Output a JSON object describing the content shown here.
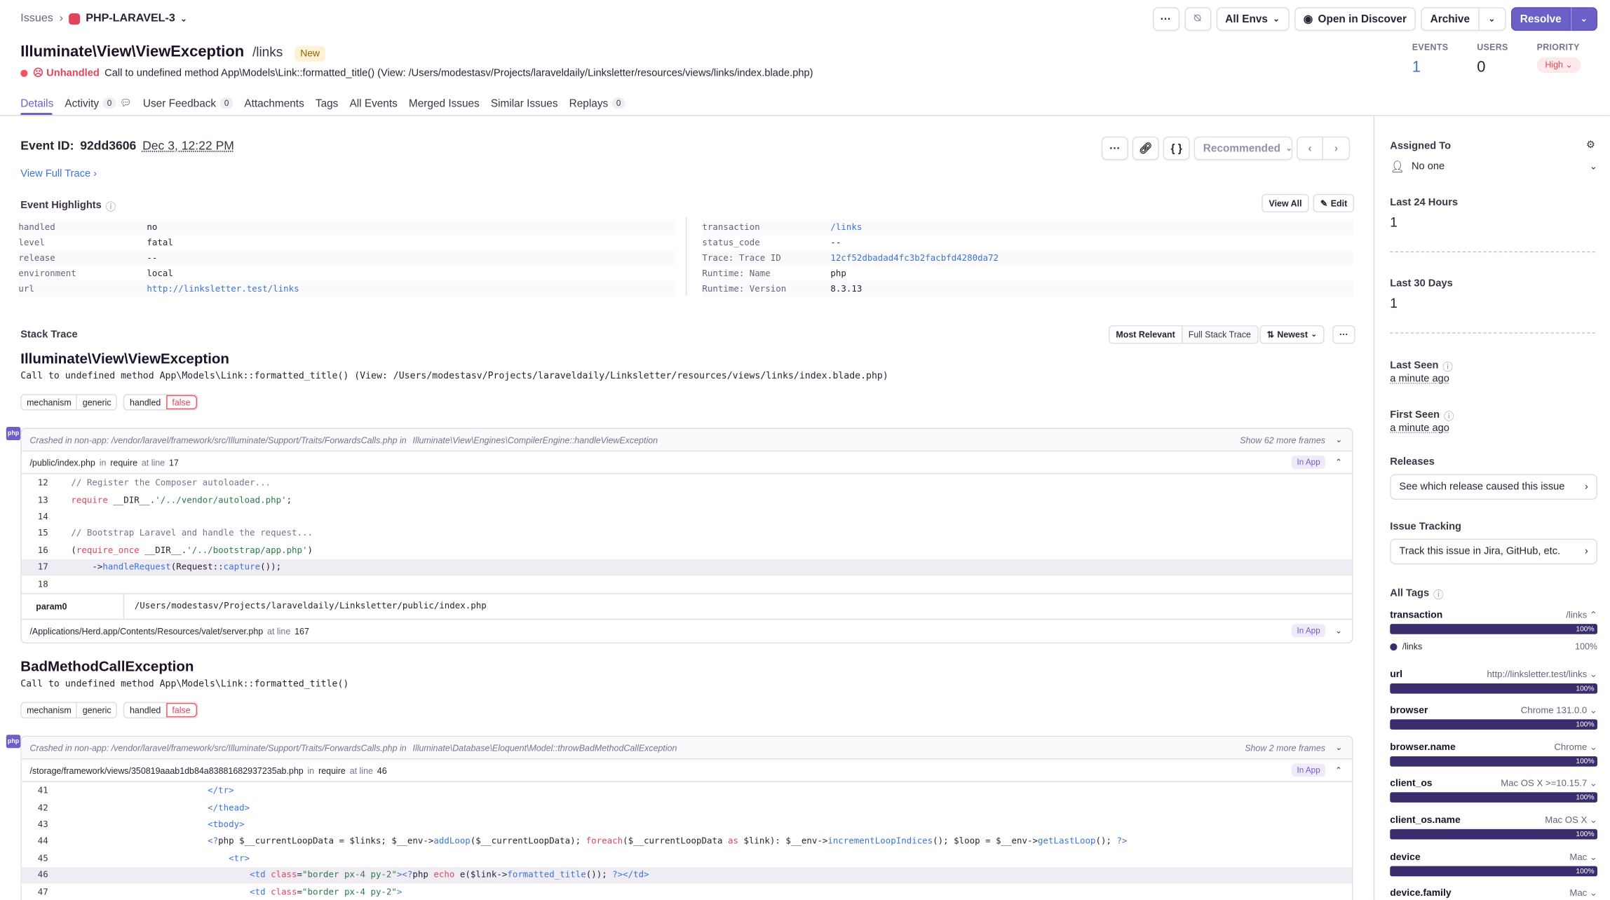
{
  "breadcrumb": {
    "root": "Issues",
    "project": "PHP-LARAVEL-3"
  },
  "toolbar": {
    "more": "···",
    "env": "All Envs",
    "discover": "Open in Discover",
    "archive": "Archive",
    "resolve": "Resolve"
  },
  "issue": {
    "title": "Illuminate\\View\\ViewException",
    "path": "/links",
    "badge": "New",
    "unhandled": "Unhandled",
    "message": "Call to undefined method App\\Models\\Link::formatted_title() (View: /Users/modestasv/Projects/laraveldaily/Linksletter/resources/views/links/index.blade.php)"
  },
  "stats": {
    "events_label": "EVENTS",
    "events": "1",
    "users_label": "USERS",
    "users": "0",
    "priority_label": "PRIORITY",
    "priority": "High"
  },
  "tabs": [
    {
      "label": "Details"
    },
    {
      "label": "Activity",
      "count": "0"
    },
    {
      "label": "User Feedback",
      "count": "0"
    },
    {
      "label": "Attachments"
    },
    {
      "label": "Tags"
    },
    {
      "label": "All Events"
    },
    {
      "label": "Merged Issues"
    },
    {
      "label": "Similar Issues"
    },
    {
      "label": "Replays",
      "count": "0"
    }
  ],
  "event": {
    "id_label": "Event ID:",
    "id": "92dd3606",
    "date": "Dec 3, 12:22 PM",
    "view_trace": "View Full Trace",
    "recommended": "Recommended"
  },
  "highlights": {
    "title": "Event Highlights",
    "view_all": "View All",
    "edit": "Edit",
    "left": [
      {
        "k": "handled",
        "v": "no"
      },
      {
        "k": "level",
        "v": "fatal"
      },
      {
        "k": "release",
        "v": "--"
      },
      {
        "k": "environment",
        "v": "local"
      },
      {
        "k": "url",
        "v": "http://linksletter.test/links"
      }
    ],
    "right": [
      {
        "k": "transaction",
        "v": "/links"
      },
      {
        "k": "status_code",
        "v": "--"
      },
      {
        "k": "Trace: Trace ID",
        "v": "12cf52dbadad4fc3b2facbfd4280da72"
      },
      {
        "k": "Runtime: Name",
        "v": "php"
      },
      {
        "k": "Runtime: Version",
        "v": "8.3.13"
      }
    ]
  },
  "stack": {
    "title": "Stack Trace",
    "most_relevant": "Most Relevant",
    "full": "Full Stack Trace",
    "newest": "Newest",
    "exc1": {
      "title": "Illuminate\\View\\ViewException",
      "msg": "Call to undefined method App\\Models\\Link::formatted_title() (View: /Users/modestasv/Projects/laraveldaily/Linksletter/resources/views/links/index.blade.php)",
      "crash_label": "Crashed in non-app:",
      "crash_path": "/vendor/laravel/framework/src/Illuminate/Support/Traits/ForwardsCalls.php",
      "crash_in": "in",
      "crash_fn": "Illuminate\\View\\Engines\\CompilerEngine::handleViewException",
      "more": "Show 62 more frames",
      "frame_file": "/public/index.php",
      "frame_in": "in",
      "frame_fn": "require",
      "frame_at": "at line",
      "frame_line": "17",
      "in_app": "In App",
      "param_k": "param0",
      "param_v": "/Users/modestasv/Projects/laraveldaily/Linksletter/public/index.php",
      "frame2_file": "/Applications/Herd.app/Contents/Resources/valet/server.php",
      "frame2_at": "at line",
      "frame2_line": "167"
    },
    "exc2": {
      "title": "BadMethodCallException",
      "msg": "Call to undefined method App\\Models\\Link::formatted_title()",
      "crash_label": "Crashed in non-app:",
      "crash_path": "/vendor/laravel/framework/src/Illuminate/Support/Traits/ForwardsCalls.php",
      "crash_in": "in",
      "crash_fn": "Illuminate\\Database\\Eloquent\\Model::throwBadMethodCallException",
      "more": "Show 2 more frames",
      "frame_file": "/storage/framework/views/350819aaab1db84a83881682937235ab.php",
      "frame_in": "in",
      "frame_fn": "require",
      "frame_at": "at line",
      "frame_line": "46",
      "in_app": "In App"
    },
    "tags": {
      "mechanism": "mechanism",
      "generic": "generic",
      "handled": "handled",
      "false": "false"
    }
  },
  "sidebar": {
    "assigned_label": "Assigned To",
    "assigned": "No one",
    "last24_label": "Last 24 Hours",
    "last24": "1",
    "last30_label": "Last 30 Days",
    "last30": "1",
    "last_seen_label": "Last Seen",
    "last_seen": "a minute ago",
    "first_seen_label": "First Seen",
    "first_seen": "a minute ago",
    "releases_label": "Releases",
    "releases_btn": "See which release caused this issue",
    "tracking_label": "Issue Tracking",
    "tracking_btn": "Track this issue in Jira, GitHub, etc.",
    "tags_label": "All Tags",
    "tags": [
      {
        "k": "transaction",
        "v": "/links",
        "pct": "100%",
        "sub": "/links",
        "sub_pct": "100%"
      },
      {
        "k": "url",
        "v": "http://linksletter.test/links",
        "pct": "100%"
      },
      {
        "k": "browser",
        "v": "Chrome 131.0.0",
        "pct": "100%"
      },
      {
        "k": "browser.name",
        "v": "Chrome",
        "pct": "100%"
      },
      {
        "k": "client_os",
        "v": "Mac OS X >=10.15.7",
        "pct": "100%"
      },
      {
        "k": "client_os.name",
        "v": "Mac OS X",
        "pct": "100%"
      },
      {
        "k": "device",
        "v": "Mac",
        "pct": "100%"
      },
      {
        "k": "device.family",
        "v": "Mac"
      }
    ]
  }
}
